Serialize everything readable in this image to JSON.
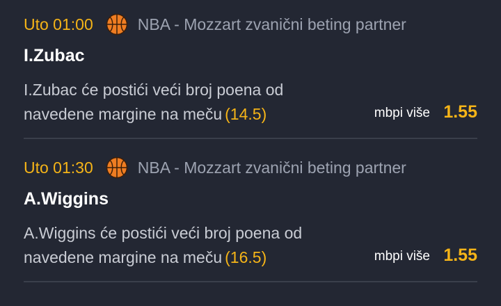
{
  "bets": [
    {
      "time": "Uto 01:00",
      "sport_icon": "basketball-icon",
      "league": "NBA - Mozzart zvanični beting partner",
      "player": "I.Zubac",
      "description": "I.Zubac će postići veći broj poena od navedene margine na meču",
      "margin": "(14.5)",
      "odd_label": "mbpi više",
      "odd_value": "1.55"
    },
    {
      "time": "Uto 01:30",
      "sport_icon": "basketball-icon",
      "league": "NBA - Mozzart zvanični beting partner",
      "player": "A.Wiggins",
      "description": "A.Wiggins će postići veći broj poena od navedene margine na meču",
      "margin": "(16.5)",
      "odd_label": "mbpi više",
      "odd_value": "1.55"
    }
  ],
  "colors": {
    "background": "#232733",
    "accent": "#f5b418",
    "muted_text": "#9da3b1",
    "divider": "#3a3f4b"
  }
}
